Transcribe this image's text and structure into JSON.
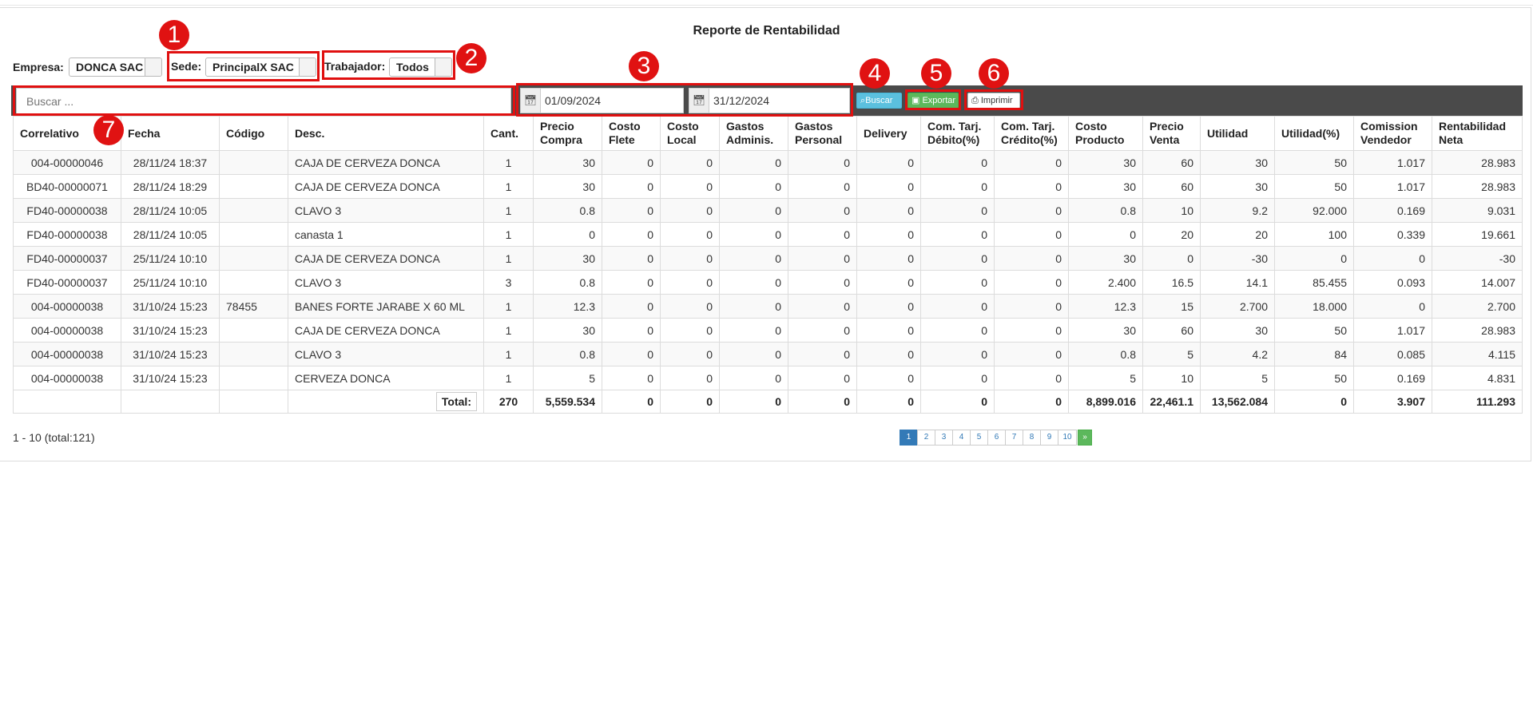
{
  "title": "Reporte de Rentabilidad",
  "filters": {
    "empresa_label": "Empresa:",
    "empresa_value": "DONCA SAC",
    "sede_label": "Sede:",
    "sede_value": "PrincipalX SAC",
    "trabajador_label": "Trabajador:",
    "trabajador_value": "Todos"
  },
  "toolbar": {
    "search_placeholder": "Buscar ...",
    "date_from": "01/09/2024",
    "date_to": "31/12/2024",
    "buscar_label": "Buscar",
    "exportar_label": "Exportar",
    "imprimir_label": "Imprimir"
  },
  "annotations": [
    "1",
    "2",
    "3",
    "4",
    "5",
    "6",
    "7"
  ],
  "table": {
    "headers": [
      "Correlativo",
      "Fecha",
      "Código",
      "Desc.",
      "Cant.",
      "Precio Compra",
      "Costo Flete",
      "Costo Local",
      "Gastos Adminis.",
      "Gastos Personal",
      "Delivery",
      "Com. Tarj. Débito(%)",
      "Com. Tarj. Crédito(%)",
      "Costo Producto",
      "Precio Venta",
      "Utilidad",
      "Utilidad(%)",
      "Comission Vendedor",
      "Rentabilidad Neta"
    ],
    "rows": [
      [
        "004-00000046",
        "28/11/24 18:37",
        "",
        "CAJA DE CERVEZA DONCA",
        "1",
        "30",
        "0",
        "0",
        "0",
        "0",
        "0",
        "0",
        "0",
        "30",
        "60",
        "30",
        "50",
        "1.017",
        "28.983"
      ],
      [
        "BD40-00000071",
        "28/11/24 18:29",
        "",
        "CAJA DE CERVEZA DONCA",
        "1",
        "30",
        "0",
        "0",
        "0",
        "0",
        "0",
        "0",
        "0",
        "30",
        "60",
        "30",
        "50",
        "1.017",
        "28.983"
      ],
      [
        "FD40-00000038",
        "28/11/24 10:05",
        "",
        "CLAVO 3",
        "1",
        "0.8",
        "0",
        "0",
        "0",
        "0",
        "0",
        "0",
        "0",
        "0.8",
        "10",
        "9.2",
        "92.000",
        "0.169",
        "9.031"
      ],
      [
        "FD40-00000038",
        "28/11/24 10:05",
        "",
        "canasta 1",
        "1",
        "0",
        "0",
        "0",
        "0",
        "0",
        "0",
        "0",
        "0",
        "0",
        "20",
        "20",
        "100",
        "0.339",
        "19.661"
      ],
      [
        "FD40-00000037",
        "25/11/24 10:10",
        "",
        "CAJA DE CERVEZA DONCA",
        "1",
        "30",
        "0",
        "0",
        "0",
        "0",
        "0",
        "0",
        "0",
        "30",
        "0",
        "-30",
        "0",
        "0",
        "-30"
      ],
      [
        "FD40-00000037",
        "25/11/24 10:10",
        "",
        "CLAVO 3",
        "3",
        "0.8",
        "0",
        "0",
        "0",
        "0",
        "0",
        "0",
        "0",
        "2.400",
        "16.5",
        "14.1",
        "85.455",
        "0.093",
        "14.007"
      ],
      [
        "004-00000038",
        "31/10/24 15:23",
        "78455",
        "BANES FORTE JARABE X 60 ML",
        "1",
        "12.3",
        "0",
        "0",
        "0",
        "0",
        "0",
        "0",
        "0",
        "12.3",
        "15",
        "2.700",
        "18.000",
        "0",
        "2.700"
      ],
      [
        "004-00000038",
        "31/10/24 15:23",
        "",
        "CAJA DE CERVEZA DONCA",
        "1",
        "30",
        "0",
        "0",
        "0",
        "0",
        "0",
        "0",
        "0",
        "30",
        "60",
        "30",
        "50",
        "1.017",
        "28.983"
      ],
      [
        "004-00000038",
        "31/10/24 15:23",
        "",
        "CLAVO 3",
        "1",
        "0.8",
        "0",
        "0",
        "0",
        "0",
        "0",
        "0",
        "0",
        "0.8",
        "5",
        "4.2",
        "84",
        "0.085",
        "4.115"
      ],
      [
        "004-00000038",
        "31/10/24 15:23",
        "",
        "CERVEZA DONCA",
        "1",
        "5",
        "0",
        "0",
        "0",
        "0",
        "0",
        "0",
        "0",
        "5",
        "10",
        "5",
        "50",
        "0.169",
        "4.831"
      ]
    ],
    "total_label": "Total:",
    "totals": [
      "270",
      "5,559.534",
      "0",
      "0",
      "0",
      "0",
      "0",
      "0",
      "0",
      "8,899.016",
      "22,461.1",
      "13,562.084",
      "0",
      "3.907",
      "111.293"
    ]
  },
  "footer": {
    "range_text": "1 - 10 (total:121)",
    "pages": [
      "1",
      "2",
      "3",
      "4",
      "5",
      "6",
      "7",
      "8",
      "9",
      "10"
    ],
    "next_label": "»",
    "active_page": "1"
  }
}
